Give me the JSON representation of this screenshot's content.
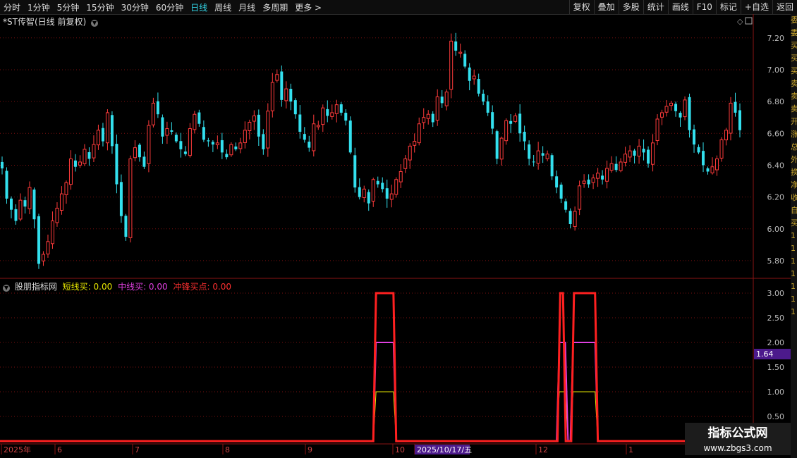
{
  "toolbar": {
    "periods": [
      "分时",
      "1分钟",
      "5分钟",
      "15分钟",
      "30分钟",
      "60分钟",
      "日线",
      "周线",
      "月线",
      "多周期",
      "更多 >"
    ],
    "active_period": "日线",
    "tools": [
      "复权",
      "叠加",
      "多股",
      "统计",
      "画线",
      "F10",
      "标记",
      "+自选",
      "返回"
    ]
  },
  "main_chart": {
    "title": "*ST传智(日线 前复权)",
    "y_ticks": [
      "7.20",
      "7.00",
      "6.80",
      "6.60",
      "6.40",
      "6.20",
      "6.00",
      "5.80"
    ]
  },
  "indicator": {
    "name": "股朋指标网",
    "items": [
      {
        "label": "短线买:",
        "value": "0.00",
        "color": "#e6e600"
      },
      {
        "label": "中线买:",
        "value": "0.00",
        "color": "#e040e0"
      },
      {
        "label": "冲锋买点:",
        "value": "0.00",
        "color": "#ff3030"
      }
    ],
    "y_ticks": [
      "3.00",
      "2.50",
      "2.00",
      "1.50",
      "1.00",
      "0.50"
    ],
    "cursor_value": "1.64"
  },
  "date_axis": {
    "labels": [
      "2025年",
      "6",
      "7",
      "8",
      "9",
      "10",
      "2025/10/17/五",
      "12",
      "1"
    ]
  },
  "side_strip": [
    "委",
    "委",
    "买",
    "买",
    "买",
    "卖",
    "卖",
    "卖",
    "开",
    "涨",
    "总",
    "外",
    "换",
    "净",
    "收",
    "自",
    "买",
    "1",
    "1",
    "1",
    "1",
    "1",
    "1",
    "1"
  ],
  "watermark": {
    "line1": "指标公式网",
    "line2": "www.zbgs3.com"
  },
  "colors": {
    "up": "#ff3b3b",
    "down": "#33e0ee",
    "grid": "#7a1010",
    "short": "#e6e600",
    "mid": "#e040e0",
    "rush": "#ff2020"
  },
  "chart_data": {
    "type": "candlestick",
    "title": "*ST传智(日线 前复权)",
    "ylim": [
      5.72,
      7.27
    ],
    "closes": [
      6.38,
      6.19,
      6.12,
      6.05,
      6.18,
      6.14,
      6.26,
      6.06,
      5.78,
      5.84,
      5.92,
      6.05,
      6.13,
      6.22,
      6.29,
      6.44,
      6.39,
      6.42,
      6.5,
      6.44,
      6.53,
      6.62,
      6.55,
      6.73,
      6.52,
      6.28,
      6.08,
      5.95,
      6.44,
      6.51,
      6.45,
      6.39,
      6.65,
      6.79,
      6.72,
      6.58,
      6.63,
      6.61,
      6.55,
      6.5,
      6.47,
      6.63,
      6.72,
      6.66,
      6.56,
      6.55,
      6.53,
      6.54,
      6.48,
      6.45,
      6.53,
      6.5,
      6.54,
      6.62,
      6.67,
      6.71,
      6.58,
      6.5,
      6.74,
      6.92,
      6.97,
      6.81,
      6.88,
      6.8,
      6.72,
      6.61,
      6.56,
      6.51,
      6.66,
      6.65,
      6.76,
      6.71,
      6.73,
      6.78,
      6.73,
      6.68,
      6.48,
      6.26,
      6.2,
      6.25,
      6.16,
      6.31,
      6.28,
      6.25,
      6.19,
      6.22,
      6.31,
      6.36,
      6.44,
      6.52,
      6.55,
      6.66,
      6.7,
      6.72,
      6.67,
      6.83,
      6.79,
      6.86,
      7.18,
      7.12,
      7.11,
      7.02,
      6.93,
      6.96,
      6.85,
      6.8,
      6.73,
      6.63,
      6.44,
      6.57,
      6.68,
      6.66,
      6.71,
      6.6,
      6.55,
      6.44,
      6.42,
      6.49,
      6.46,
      6.47,
      6.33,
      6.26,
      6.19,
      6.12,
      6.03,
      6.11,
      6.27,
      6.3,
      6.28,
      6.32,
      6.35,
      6.31,
      6.38,
      6.41,
      6.37,
      6.42,
      6.47,
      6.49,
      6.46,
      6.52,
      6.48,
      6.41,
      6.54,
      6.69,
      6.73,
      6.77,
      6.79,
      6.74,
      6.7,
      6.81,
      6.62,
      6.53,
      6.48,
      6.4,
      6.36,
      6.39,
      6.44,
      6.56,
      6.62,
      6.79,
      6.73,
      6.62
    ]
  }
}
